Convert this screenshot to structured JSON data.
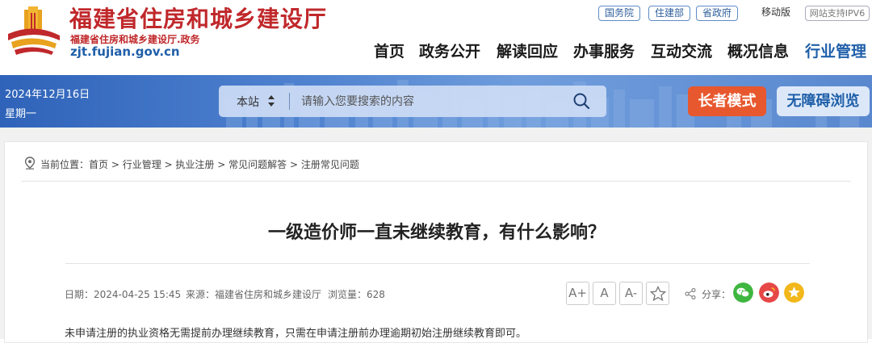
{
  "header": {
    "site_title": "福建省住房和城乡建设厅",
    "site_subtitle": "福建省住房和城乡建设厅.政务",
    "site_domain": "zjt.fujian.gov.cn",
    "top_links": [
      "国务院",
      "住建部",
      "省政府"
    ],
    "mobile_label": "移动版",
    "ipv6_label": "网站支持IPV6",
    "nav": [
      "首页",
      "政务公开",
      "解读回应",
      "办事服务",
      "互动交流",
      "概况信息",
      "行业管理"
    ],
    "active_nav": "行业管理",
    "brand_color": "#c0282b",
    "accent_color": "#1f5fa9"
  },
  "band": {
    "date": "2024年12月16日",
    "weekday": "星期一",
    "search_scope": "本站",
    "search_placeholder": "请输入您要搜索的内容",
    "search_icon": "search-icon",
    "elder_mode_label": "长者模式",
    "accessible_label": "无障碍浏览",
    "elder_color": "#e8582e"
  },
  "breadcrumb": {
    "prefix": "当前位置：",
    "items": [
      "首页",
      "行业管理",
      "执业注册",
      "常见问题解答",
      "注册常见问题"
    ],
    "separator": " > "
  },
  "article": {
    "title": "一级造价师一直未继续教育，有什么影响？",
    "date_label": "日期：",
    "date": "2024-04-25 15:45",
    "source_label": "来源：",
    "source": "福建省住房和城乡建设厅",
    "views_label": "浏览量：",
    "views": "628",
    "font_buttons": [
      "A+",
      "A",
      "A-"
    ],
    "share_label": "分享：",
    "share_icons": [
      "wechat-icon",
      "weibo-icon",
      "qzone-icon"
    ],
    "body": "未申请注册的执业资格无需提前办理继续教育，只需在申请注册前办理逾期初始注册继续教育即可。"
  }
}
